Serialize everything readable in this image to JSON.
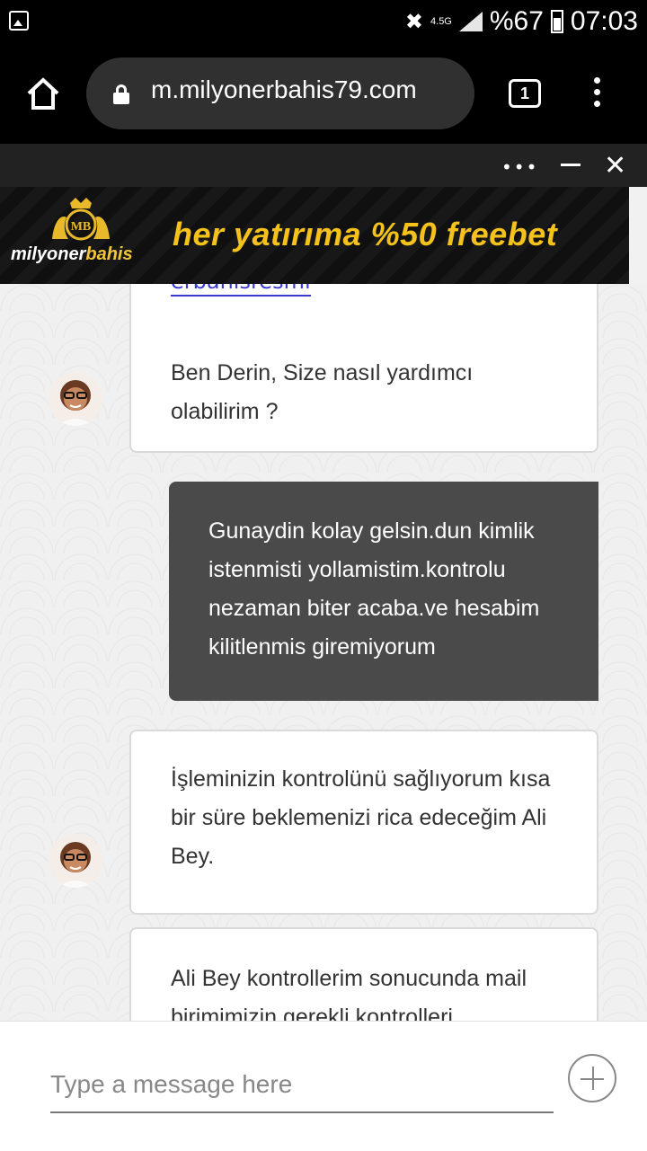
{
  "status_bar": {
    "network": "4.5G",
    "battery": "%67",
    "time": "07:03"
  },
  "browser": {
    "url": "m.milyonerbahis79.com",
    "tab_count": "1"
  },
  "ad": {
    "brand_prefix": "milyoner",
    "brand_suffix": "bahis",
    "slogan": "her yatırıma %50 freebet",
    "crest_letters": "MB"
  },
  "chat": {
    "cut_link": "erbahisresmi",
    "messages": [
      {
        "sender": "agent",
        "text": "Ben Derin, Size nasıl yardımcı olabilirim ?"
      },
      {
        "sender": "user",
        "text": "Gunaydin kolay gelsin.dun kimlik istenmisti yollamistim.kontrolu nezaman biter acaba.ve hesabim kilitlenmis giremiyorum"
      },
      {
        "sender": "agent",
        "text": "İşleminizin kontrolünü sağlıyorum kısa bir süre beklemenizi rica edeceğim Ali Bey."
      },
      {
        "sender": "agent",
        "text": "Ali Bey kontrollerim sonucunda mail birimimizin gerekli kontrolleri"
      }
    ]
  },
  "input": {
    "placeholder": "Type a message here"
  }
}
